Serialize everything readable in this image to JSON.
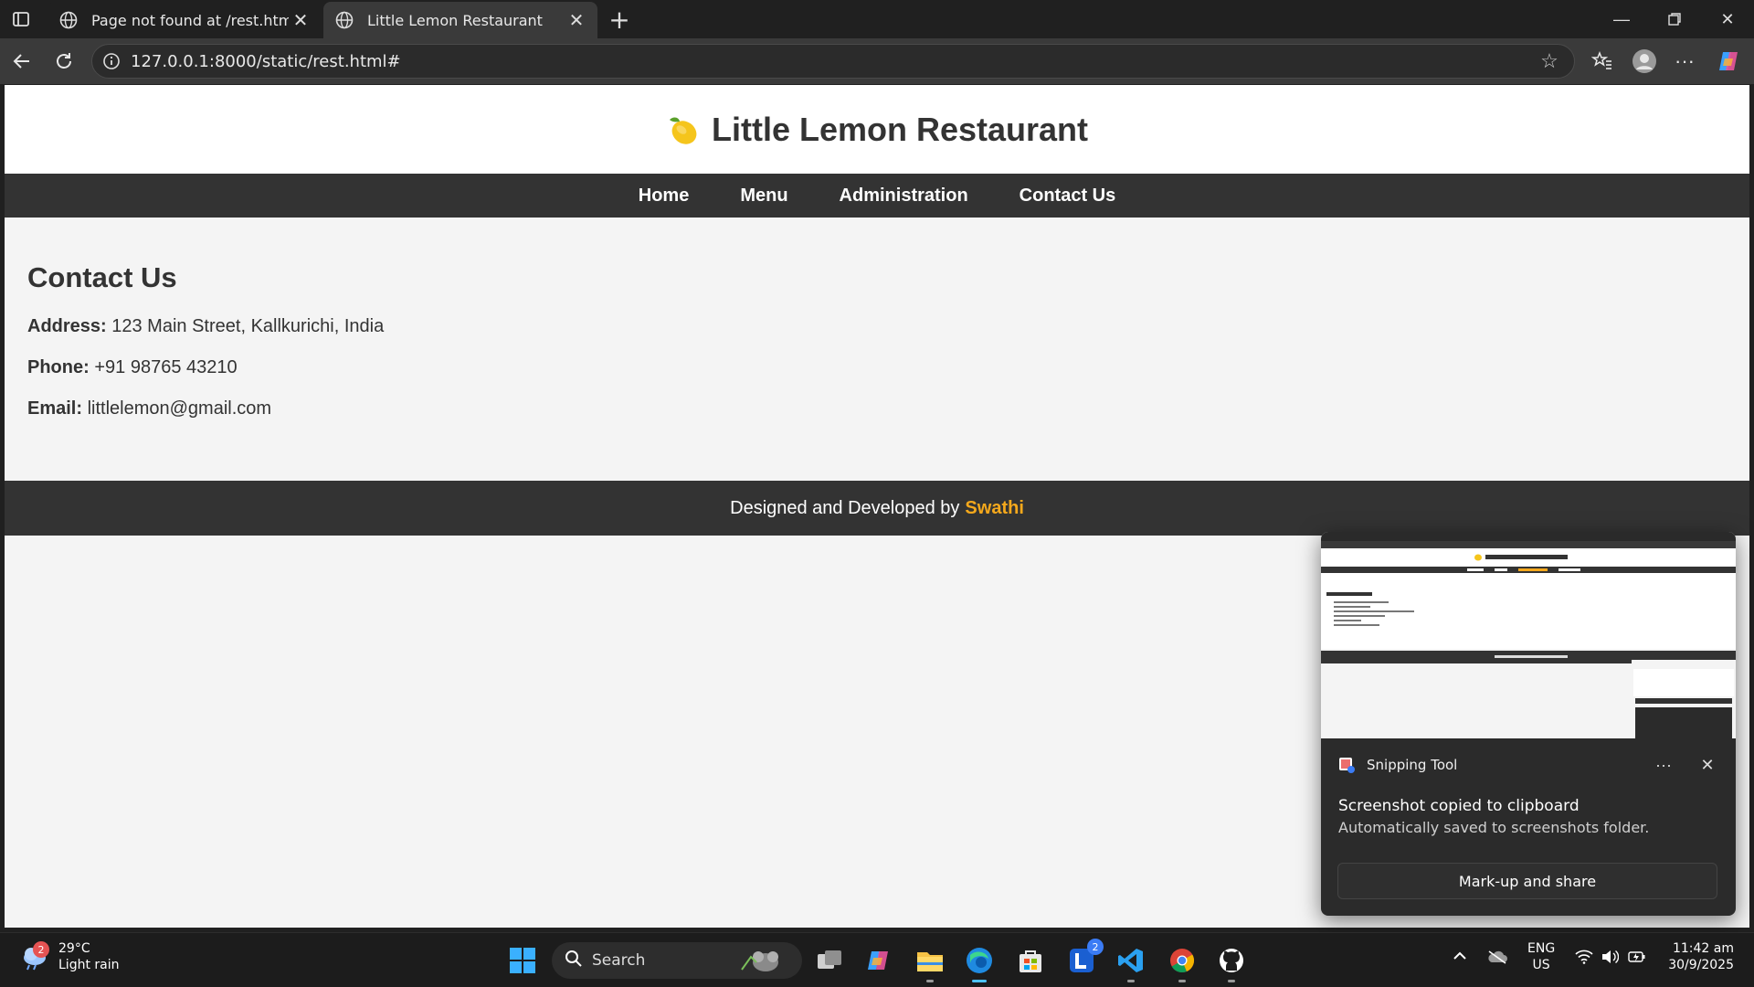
{
  "browser": {
    "tabs": [
      {
        "title": "Page not found at /rest.html",
        "favicon": "globe-icon"
      },
      {
        "title": "Little Lemon Restaurant",
        "favicon": "globe-icon"
      }
    ],
    "url": "127.0.0.1:8000/static/rest.html#"
  },
  "site": {
    "title": "Little Lemon Restaurant",
    "logo_icon": "lemon-icon",
    "nav": [
      "Home",
      "Menu",
      "Administration",
      "Contact Us"
    ],
    "section_title": "Contact Us",
    "address_label": "Address:",
    "address_value": " 123 Main Street, Kallkurichi, India",
    "phone_label": "Phone:",
    "phone_value": " +91 98765 43210",
    "email_label": "Email:",
    "email_value": " littlelemon@gmail.com",
    "footer_text": "Designed and Developed by",
    "footer_author": "Swathi",
    "accent_color": "#f4a81c"
  },
  "toast": {
    "app_name": "Snipping Tool",
    "message": "Screenshot copied to clipboard",
    "sub_message": "Automatically saved to screenshots folder.",
    "button_label": "Mark-up and share"
  },
  "taskbar": {
    "weather_temp": "29°C",
    "weather_desc": "Light rain",
    "weather_badge": "2",
    "search_label": "Search",
    "lang_primary": "ENG",
    "lang_secondary": "US",
    "time": "11:42 am",
    "date": "30/9/2025",
    "app_badge": "2"
  }
}
